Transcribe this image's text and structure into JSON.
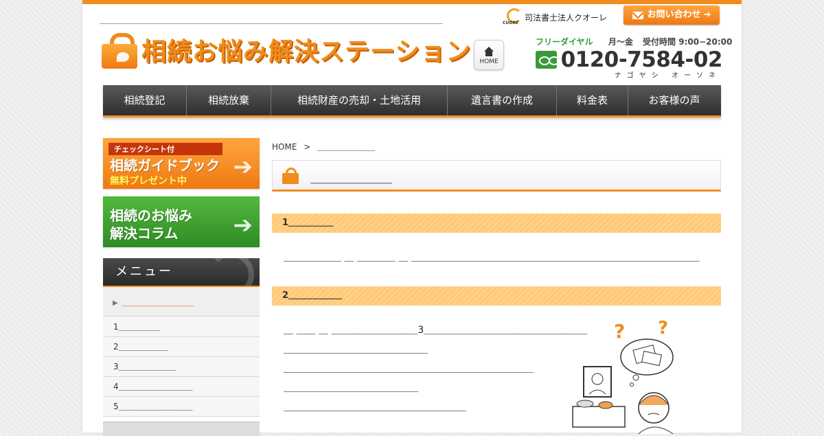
{
  "header": {
    "tagline": "＿＿＿＿＿＿＿＿＿＿＿＿＿＿＿＿＿＿＿＿＿＿＿＿＿＿＿＿＿＿＿＿＿＿＿＿＿＿＿＿",
    "logo_text": "相続お悩み解決ステーション",
    "home_label": "HOME",
    "firm_name": "司法書士法人クオーレ",
    "firm_logo_text": "CUORE",
    "contact_label": "お問い合わせ",
    "freedial_label": "フリーダイヤル",
    "days": "月〜金",
    "hours": "受付時間 9:00−20:00",
    "phone": "0120-7584-02",
    "phone_kana": "ナゴヤシ オーソネ"
  },
  "nav": {
    "items": [
      {
        "label": "相続登記"
      },
      {
        "label": "相続放棄"
      },
      {
        "label": "相続財産の売却・土地活用"
      },
      {
        "label": "遺言書の作成"
      },
      {
        "label": "料金表"
      },
      {
        "label": "お客様の声"
      }
    ]
  },
  "sidebar": {
    "guide_banner": {
      "tag": "チェックシート付",
      "line1": "相続ガイドブック",
      "line2": "無料プレゼント中"
    },
    "column_banner": {
      "line1": "相続のお悩み",
      "line2": "解決コラム"
    },
    "menu_title": "メニュー",
    "active_item": "＿＿＿＿＿＿＿",
    "sub_items": [
      {
        "label": "1＿＿＿＿＿"
      },
      {
        "label": "2＿＿＿＿＿＿"
      },
      {
        "label": "3＿＿＿＿＿＿＿"
      },
      {
        "label": "4＿＿＿＿＿＿＿＿＿"
      },
      {
        "label": "5＿＿＿＿＿＿＿＿＿"
      }
    ]
  },
  "main": {
    "breadcrumb_home": "HOME",
    "breadcrumb_sep": ">",
    "breadcrumb_current": "＿＿＿＿＿＿＿",
    "page_title": "＿＿＿＿＿＿＿",
    "section1_title": "1＿＿＿＿＿",
    "section1_text": "＿＿＿＿＿＿ ＿ ＿＿＿＿ ＿ ＿＿＿＿＿＿＿＿＿＿＿＿＿＿＿＿＿＿＿＿＿＿＿＿＿＿＿＿＿＿",
    "section2_title": "2＿＿＿＿＿＿",
    "section2_lines": [
      "＿ ＿＿ ＿ ＿＿＿＿＿＿＿＿＿3＿＿＿＿＿＿＿＿＿＿＿＿＿＿＿＿＿",
      "＿＿＿＿＿＿＿＿＿＿＿＿＿＿＿",
      "＿＿＿＿＿＿＿＿＿＿＿＿＿＿＿＿＿＿＿＿＿＿＿＿＿＿",
      "＿＿＿＿＿＿＿＿＿＿＿＿＿＿",
      "＿＿＿＿＿＿＿＿＿＿＿＿＿＿＿＿＿＿＿"
    ]
  },
  "colors": {
    "accent": "#f08c1e",
    "nav_bg": "#3a3a3a",
    "green": "#3a9a3a",
    "section_bg": "#ffcb7c",
    "active_menu_text": "#e8602a"
  }
}
